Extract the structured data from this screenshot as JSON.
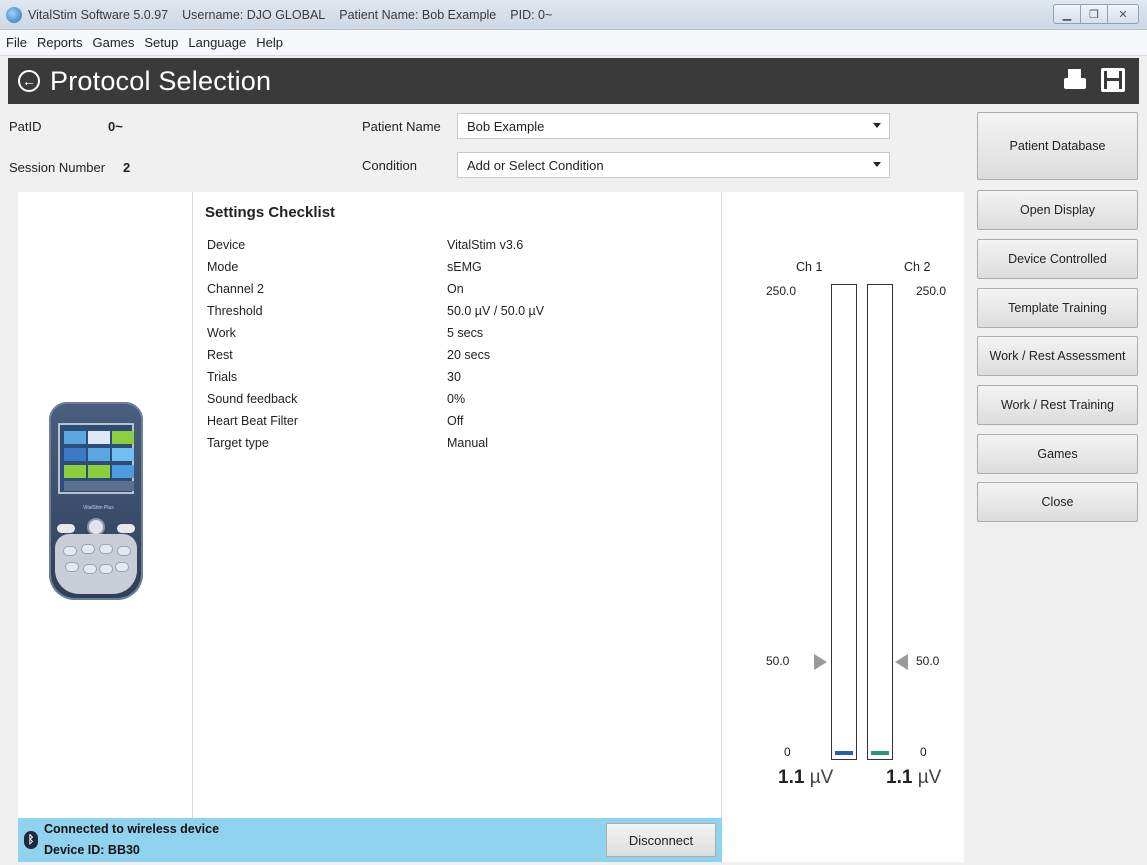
{
  "titlebar": {
    "app": "VitalStim Software 5.0.97",
    "username": "Username: DJO GLOBAL",
    "patient": "Patient Name: Bob Example",
    "pid": "PID: 0~"
  },
  "menu": [
    "File",
    "Reports",
    "Games",
    "Setup",
    "Language",
    "Help"
  ],
  "header": {
    "title": "Protocol Selection"
  },
  "patient_info": {
    "patid_label": "PatID",
    "patid_value": "0~",
    "session_label": "Session Number",
    "session_value": "2",
    "name_label": "Patient Name",
    "name_value": "Bob Example",
    "condition_label": "Condition",
    "condition_placeholder": "Add or Select Condition"
  },
  "checklist": {
    "title": "Settings Checklist",
    "rows": [
      {
        "key": "Device",
        "value": "VitalStim v3.6"
      },
      {
        "key": "Mode",
        "value": "sEMG"
      },
      {
        "key": "Channel 2",
        "value": "On"
      },
      {
        "key": "Threshold",
        "value": "50.0 µV / 50.0 µV"
      },
      {
        "key": "Work",
        "value": "5 secs"
      },
      {
        "key": "Rest",
        "value": "20 secs"
      },
      {
        "key": "Trials",
        "value": "30"
      },
      {
        "key": "Sound feedback",
        "value": "0%"
      },
      {
        "key": "Heart Beat Filter",
        "value": "Off"
      },
      {
        "key": "Target type",
        "value": "Manual"
      }
    ]
  },
  "status": {
    "connection": "Connected to wireless device",
    "device_id": "Device ID: BB30",
    "disconnect_label": "Disconnect"
  },
  "device_image": {
    "brand": "VitalStim Plus"
  },
  "chart_data": {
    "type": "bar",
    "categories": [
      "Ch 1",
      "Ch 2"
    ],
    "ylim": [
      0,
      250
    ],
    "ticks": {
      "top": "250.0",
      "threshold": "50.0",
      "bottom": "0"
    },
    "threshold": [
      50.0,
      50.0
    ],
    "values": [
      1.1,
      1.1
    ],
    "unit": "µV",
    "readings": [
      "1.1",
      "1.1"
    ],
    "colors": {
      "ch1": "#2a5db0",
      "ch2": "#1f9a7f"
    }
  },
  "sidebar": {
    "buttons": [
      "Patient Database",
      "Open Display",
      "Device Controlled",
      "Template Training",
      "Work / Rest Assessment",
      "Work / Rest Training",
      "Games",
      "Close"
    ]
  }
}
